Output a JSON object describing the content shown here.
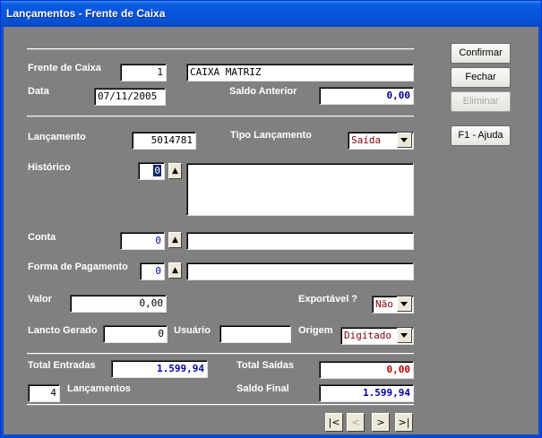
{
  "window": {
    "title": "Lançamentos - Frente de Caixa"
  },
  "buttons": {
    "confirmar": "Confirmar",
    "fechar": "Fechar",
    "eliminar": "Eliminar",
    "ajuda": "F1 - Ajuda"
  },
  "header": {
    "frente_caixa_label": "Frente de Caixa",
    "frente_caixa_num": "1",
    "frente_caixa_nome": "CAIXA MATRIZ",
    "data_label": "Data",
    "data_value": "07/11/2005",
    "saldo_anterior_label": "Saldo Anterior",
    "saldo_anterior_value": "0,00"
  },
  "lancamento": {
    "label": "Lançamento",
    "value": "5014781",
    "tipo_label": "Tipo Lançamento",
    "tipo_value": "Saída",
    "historico_label": "Histórico",
    "historico_code": "0",
    "historico_text": "",
    "conta_label": "Conta",
    "conta_code": "0",
    "conta_text": "",
    "forma_label": "Forma de Pagamento",
    "forma_code": "0",
    "forma_text": "",
    "valor_label": "Valor",
    "valor_value": "0,00",
    "exportavel_label": "Exportável ?",
    "exportavel_value": "Não",
    "gerado_label": "Lancto Gerado",
    "gerado_value": "0",
    "usuario_label": "Usuário",
    "usuario_value": "",
    "origem_label": "Origem",
    "origem_value": "Digitado"
  },
  "totals": {
    "entradas_label": "Total Entradas",
    "entradas_value": "1.599,94",
    "saidas_label": "Total Saídas",
    "saidas_value": "0,00",
    "count_value": "4",
    "count_label": "Lançamentos",
    "saldo_final_label": "Saldo Final",
    "saldo_final_value": "1.599,94"
  },
  "nav": {
    "first": "|<",
    "prev": "<",
    "next": ">",
    "last": ">|"
  }
}
